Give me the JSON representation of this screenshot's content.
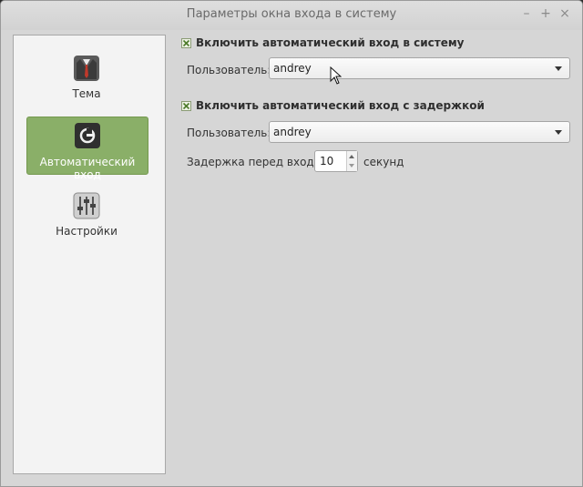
{
  "window": {
    "title": "Параметры окна входа в систему",
    "minimize_label": "–",
    "maximize_label": "+",
    "close_label": "×"
  },
  "sidebar": {
    "items": [
      {
        "label": "Тема",
        "icon": "suit-tie-icon",
        "active": false
      },
      {
        "label": "Автоматический вход",
        "icon": "power-login-icon",
        "active": true
      },
      {
        "label": "Настройки",
        "icon": "sliders-settings-icon",
        "active": false
      }
    ]
  },
  "autologin": {
    "checkbox_label": "Включить автоматический вход в систему",
    "checked": true,
    "user_label": "Пользователь:",
    "user_value": "andrey"
  },
  "timedlogin": {
    "checkbox_label": "Включить автоматический вход с задержкой",
    "checked": true,
    "user_label": "Пользователь:",
    "user_value": "andrey",
    "delay_label": "Задержка перед входом:",
    "delay_value": "10",
    "delay_unit": "секунд"
  },
  "colors": {
    "active_item_bg": "#8aaf68",
    "window_bg": "#d6d6d6",
    "sidebar_bg": "#f3f3f3"
  }
}
